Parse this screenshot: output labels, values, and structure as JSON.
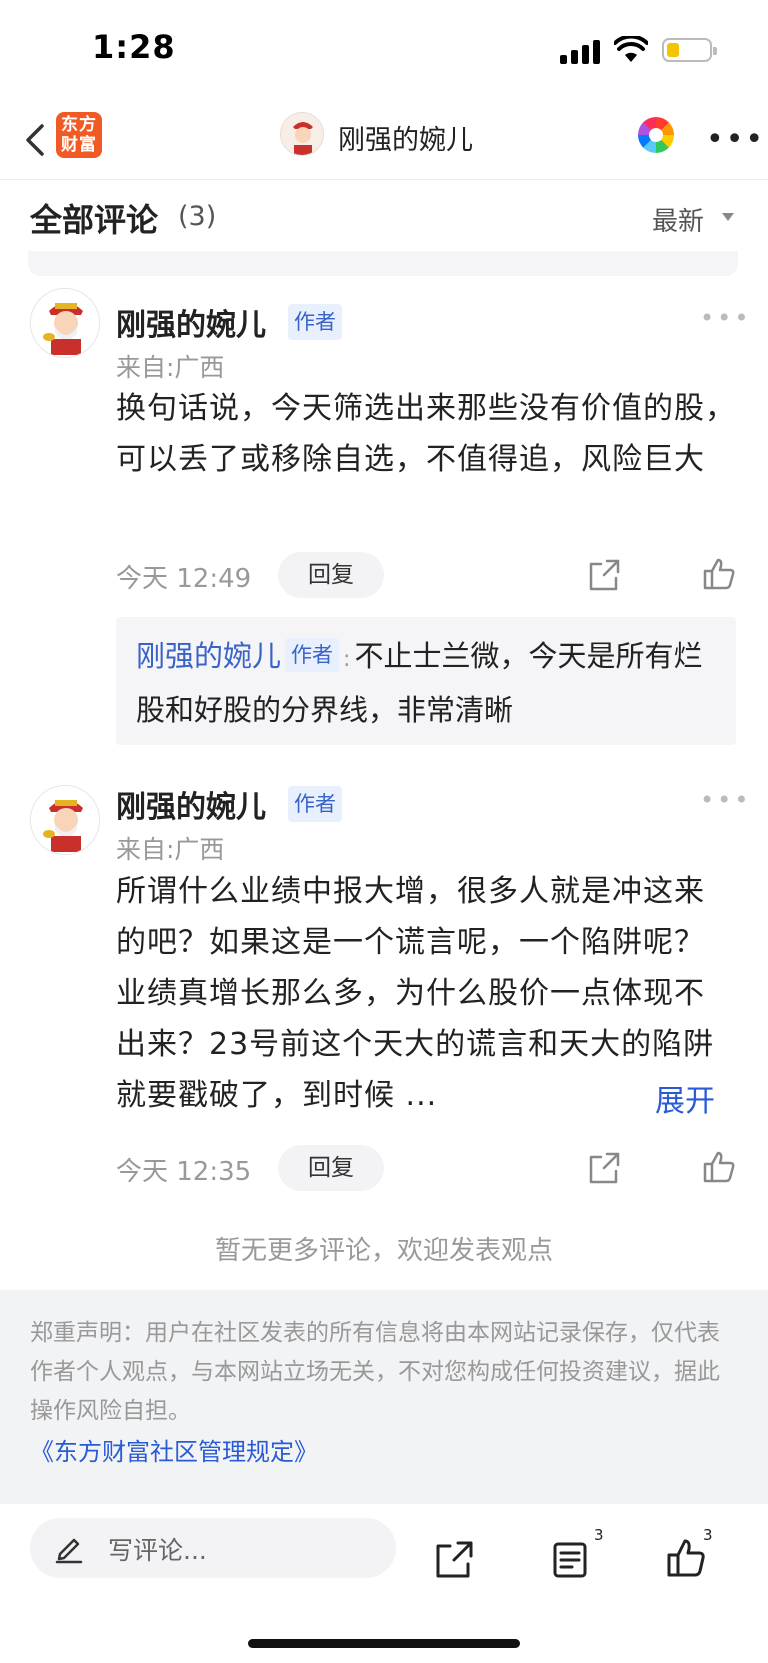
{
  "status_bar": {
    "time": "1:28"
  },
  "nav": {
    "logo_text_line1": "东方",
    "logo_text_line2": "财富",
    "title": "刚强的婉儿"
  },
  "comments_header": {
    "title": "全部评论",
    "count": "(3)",
    "sort_label": "最新"
  },
  "comments": [
    {
      "username": "刚强的婉儿",
      "badge": "作者",
      "location": "来自:广西",
      "body": "换句话说，今天筛选出来那些没有价值的股，可以丢了或移除自选，不值得追，风险巨大",
      "time": "今天 12:49",
      "reply_label": "回复",
      "reply": {
        "username": "刚强的婉儿",
        "badge": "作者",
        "separator": ":",
        "text": "不止士兰微，今天是所有烂股和好股的分界线，非常清晰"
      }
    },
    {
      "username": "刚强的婉儿",
      "badge": "作者",
      "location": "来自:广西",
      "body": "所谓什么业绩中报大增，很多人就是冲这来的吧？如果这是一个谎言呢，一个陷阱呢？业绩真增长那么多，为什么股价一点体现不出来？23号前这个天大的谎言和天大的陷阱就要戳破了，到时候 ...",
      "expand_label": "展开",
      "time": "今天 12:35",
      "reply_label": "回复"
    }
  ],
  "no_more_text": "暂无更多评论，欢迎发表观点",
  "disclaimer": {
    "text": "郑重声明：用户在社区发表的所有信息将由本网站记录保存，仅代表作者个人观点，与本网站立场无关，不对您构成任何投资建议，据此操作风险自担。",
    "link": "《东方财富社区管理规定》"
  },
  "bottom_bar": {
    "input_placeholder": "写评论...",
    "comment_count": "3",
    "like_count": "3"
  },
  "colors": {
    "brand_orange": "#f15a24",
    "link_blue": "#2a5bd7",
    "badge_blue": "#3a63c8"
  }
}
